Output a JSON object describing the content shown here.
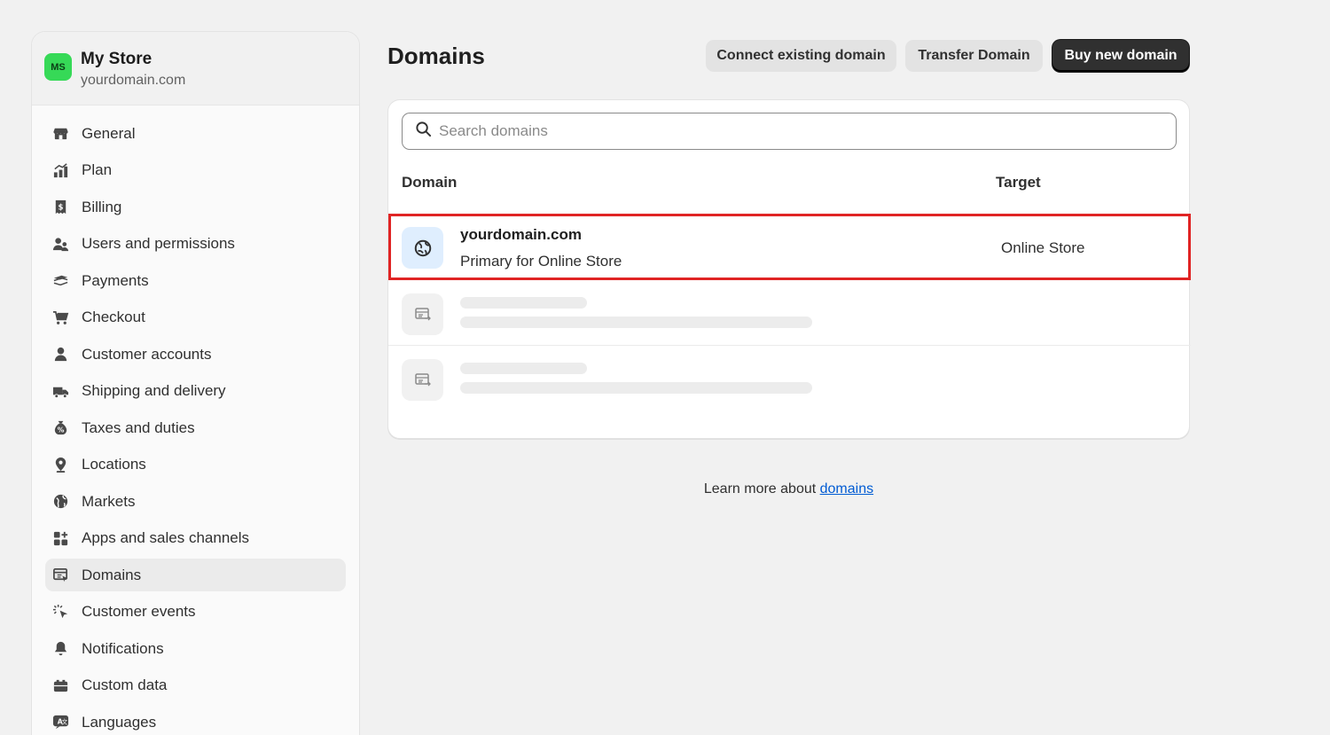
{
  "store": {
    "initials": "MS",
    "name": "My Store",
    "domain": "yourdomain.com"
  },
  "sidebar": {
    "items": [
      {
        "label": "General",
        "icon": "store-icon"
      },
      {
        "label": "Plan",
        "icon": "plan-chart-icon"
      },
      {
        "label": "Billing",
        "icon": "receipt-icon"
      },
      {
        "label": "Users and permissions",
        "icon": "users-icon"
      },
      {
        "label": "Payments",
        "icon": "payments-icon"
      },
      {
        "label": "Checkout",
        "icon": "cart-icon"
      },
      {
        "label": "Customer accounts",
        "icon": "person-icon"
      },
      {
        "label": "Shipping and delivery",
        "icon": "truck-icon"
      },
      {
        "label": "Taxes and duties",
        "icon": "tax-bag-icon"
      },
      {
        "label": "Locations",
        "icon": "location-pin-icon"
      },
      {
        "label": "Markets",
        "icon": "globe-icon"
      },
      {
        "label": "Apps and sales channels",
        "icon": "apps-grid-icon"
      },
      {
        "label": "Domains",
        "icon": "domains-icon"
      },
      {
        "label": "Customer events",
        "icon": "cursor-click-icon"
      },
      {
        "label": "Notifications",
        "icon": "bell-icon"
      },
      {
        "label": "Custom data",
        "icon": "database-icon"
      },
      {
        "label": "Languages",
        "icon": "language-icon"
      }
    ],
    "active": "Domains"
  },
  "header": {
    "title": "Domains",
    "connect_label": "Connect existing domain",
    "transfer_label": "Transfer Domain",
    "buy_label": "Buy new domain"
  },
  "search": {
    "placeholder": "Search domains"
  },
  "table": {
    "columns": [
      "Domain",
      "Target"
    ],
    "rows": [
      {
        "domain": "yourdomain.com",
        "subtitle": "Primary for Online Store",
        "target": "Online Store"
      }
    ]
  },
  "footer": {
    "text": "Learn more about ",
    "link": "domains"
  },
  "colors": {
    "avatar": "#36d957",
    "primary_button": "#303030",
    "highlight": "#e02424",
    "link": "#005bd3"
  }
}
